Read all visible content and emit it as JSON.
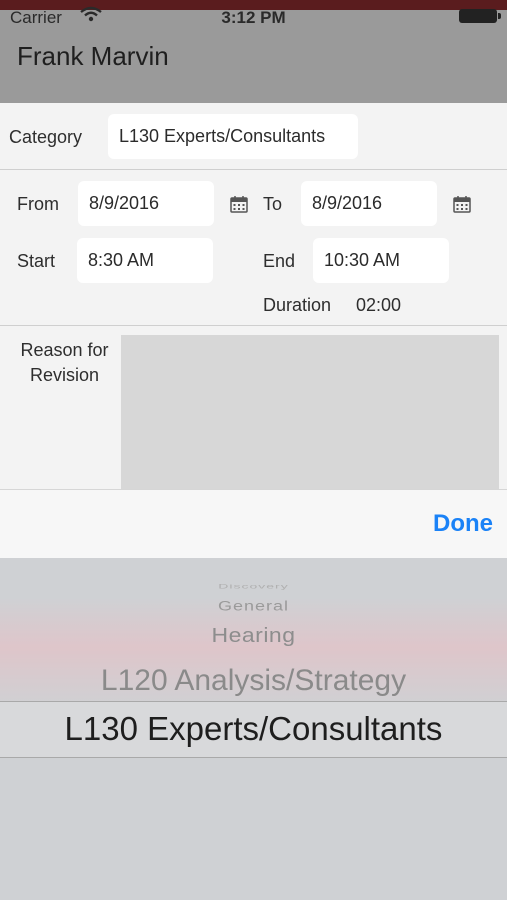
{
  "status_bar": {
    "carrier": "Carrier",
    "time": "3:12 PM"
  },
  "header": {
    "title": "Frank Marvin"
  },
  "form": {
    "category_label": "Category",
    "category_value": "L130  Experts/Consultants",
    "from_label": "From",
    "from_value": "8/9/2016",
    "to_label": "To",
    "to_value": "8/9/2016",
    "start_label": "Start",
    "start_value": "8:30 AM",
    "end_label": "End",
    "end_value": "10:30 AM",
    "duration_label": "Duration",
    "duration_value": "02:00",
    "reason_label_line1": "Reason for",
    "reason_label_line2": "Revision",
    "reason_value": ""
  },
  "toolbar": {
    "done_label": "Done"
  },
  "picker": {
    "options": [
      "Discovery",
      "General",
      "Hearing",
      "L120  Analysis/Strategy",
      "L130  Experts/Consultants"
    ],
    "selected": "L130  Experts/Consultants"
  },
  "colors": {
    "accent": "#1a82f7",
    "header_bg": "#9a9a9a"
  }
}
